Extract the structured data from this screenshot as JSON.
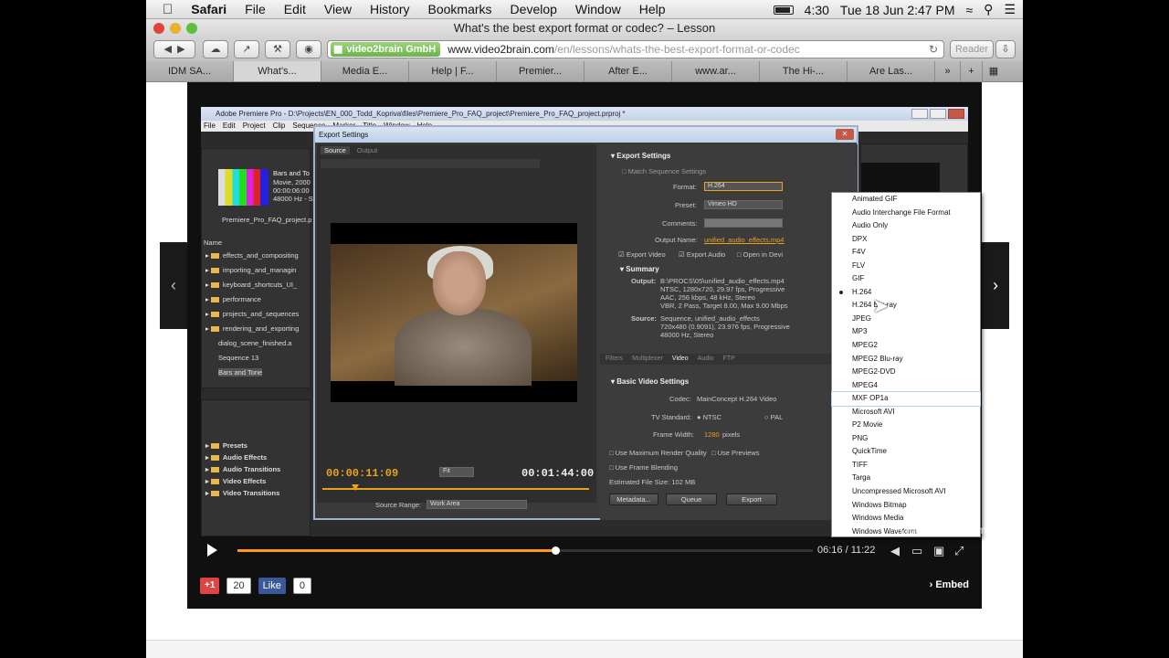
{
  "menubar": {
    "app": "Safari",
    "items": [
      "File",
      "Edit",
      "View",
      "History",
      "Bookmarks",
      "Develop",
      "Window",
      "Help"
    ],
    "time_short": "4:30",
    "datetime": "Tue 18 Jun  2:47 PM"
  },
  "window": {
    "title": "What's the best export format or codec? – Lesson"
  },
  "urlbar": {
    "site_badge": "video2brain GmbH",
    "url_host": "www.video2brain.com",
    "url_path": "/en/lessons/whats-the-best-export-format-or-codec",
    "reader": "Reader"
  },
  "tabs": [
    "IDM SA...",
    "What's...",
    "Media E...",
    "Help | F...",
    "Premier...",
    "After E...",
    "www.ar...",
    "The Hi-...",
    "Are Las..."
  ],
  "premiere": {
    "title": "Adobe Premiere Pro - D:\\Projects\\EN_000_Todd_Kopriva\\files\\Premiere_Pro_FAQ_project\\Premiere_Pro_FAQ_project.prproj *",
    "menu": [
      "File",
      "Edit",
      "Project",
      "Clip",
      "Sequence",
      "Marker",
      "Title",
      "Window",
      "Help"
    ],
    "project_clip": "Bars and To",
    "project_clip_info": [
      "Movie, 2000",
      "00:00:06:00",
      "48000 Hz - S"
    ],
    "project_file": "Premiere_Pro_FAQ_project.p",
    "name_header": "Name",
    "bins": [
      "effects_and_compositing",
      "importing_and_managin",
      "keyboard_shortcuts_UI_",
      "performance",
      "projects_and_sequences",
      "rendering_and_exporting",
      "dialog_scene_finished.a",
      "Sequence 13",
      "Bars and Tone"
    ],
    "effects": [
      "Presets",
      "Audio Effects",
      "Audio Transitions",
      "Video Effects",
      "Video Transitions"
    ]
  },
  "export_dialog": {
    "title": "Export Settings",
    "tabs": [
      "Source",
      "Output"
    ],
    "timecode_current": "00:00:11:09",
    "timecode_duration": "00:01:44:00",
    "fit": "Fit",
    "source_range_label": "Source Range:",
    "source_range": "Work Area",
    "export_settings_header": "Export Settings",
    "match_sequence": "Match Sequence Settings",
    "format_label": "Format:",
    "format_value": "H.264",
    "preset_label": "Preset:",
    "preset_value": "Vimeo HD",
    "comments_label": "Comments:",
    "output_name_label": "Output Name:",
    "output_name_value": "unified_audio_effects.mp4",
    "export_video": "Export Video",
    "export_audio": "Export Audio",
    "open_in_device": "Open in Devi",
    "summary_header": "Summary",
    "output_label": "Output:",
    "output_lines": [
      "B:\\PROCS\\05\\unified_audio_effects.mp4",
      "NTSC, 1280x720, 29.97 fps, Progressive",
      "AAC, 256 kbps, 48 kHz, Stereo",
      "VBR, 2 Pass, Target 8.00, Max 9.00 Mbps"
    ],
    "source_label": "Source:",
    "source_lines": [
      "Sequence, unified_audio_effects",
      "720x480 (0.9091), 23.976 fps, Progressive",
      "48000 Hz, Stereo"
    ],
    "setting_tabs": [
      "Filters",
      "Multiplexer",
      "Video",
      "Audio",
      "FTP"
    ],
    "basic_video_header": "Basic Video Settings",
    "codec_label": "Codec:",
    "codec_value": "MainConcept H.264 Video",
    "tv_standard_label": "TV Standard:",
    "tv_ntsc": "NTSC",
    "tv_pal": "PAL",
    "frame_width_label": "Frame Width:",
    "frame_width_value": "1280",
    "frame_width_unit": "pixels",
    "use_max_render": "Use Maximum Render Quality",
    "use_previews": "Use Previews",
    "use_frame_blending": "Use Frame Blending",
    "estimated_size": "Estimated File Size: 102 MB",
    "btn_metadata": "Metadata...",
    "btn_queue": "Queue",
    "btn_export": "Export"
  },
  "format_list": {
    "items": [
      "Animated GIF",
      "Audio Interchange File Format",
      "Audio Only",
      "DPX",
      "F4V",
      "FLV",
      "GIF",
      "H.264",
      "H.264 Blu-ray",
      "JPEG",
      "MP3",
      "MPEG2",
      "MPEG2 Blu-ray",
      "MPEG2-DVD",
      "MPEG4",
      "MXF OP1a",
      "Microsoft AVI",
      "P2 Movie",
      "PNG",
      "QuickTime",
      "TIFF",
      "Targa",
      "Uncompressed Microsoft AVI",
      "Windows Bitmap",
      "Windows Media",
      "Windows Waveform"
    ],
    "selected": "H.264",
    "highlighted": "MXF OP1a"
  },
  "player": {
    "watermark": "video2brain.com",
    "time": "06:16 / 11:22",
    "progress_fraction": 0.552,
    "accent": "#ff9a1a"
  },
  "social": {
    "gplus": "+1",
    "gplus_count": "20",
    "like": "Like",
    "like_count": "0",
    "embed": "Embed"
  }
}
